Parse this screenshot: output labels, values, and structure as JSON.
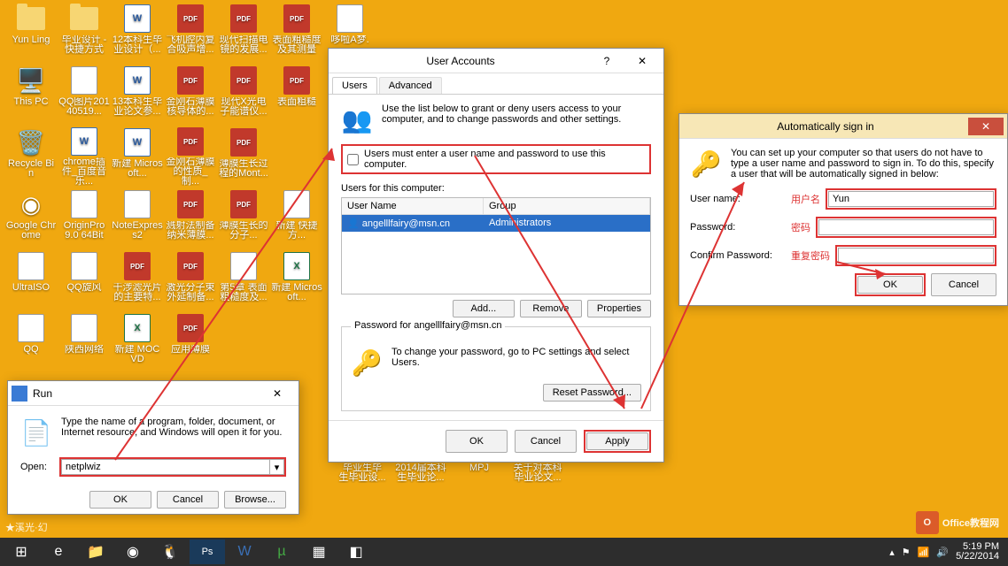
{
  "desktop_icons": [
    {
      "label": "Yun Ling",
      "type": "folder"
    },
    {
      "label": "毕业设计 - 快捷方式",
      "type": "folder"
    },
    {
      "label": "12本科生毕业设计（...",
      "type": "docx"
    },
    {
      "label": "飞机腔内复合吸声增...",
      "type": "pdf"
    },
    {
      "label": "现代扫描电镜的发展...",
      "type": "pdf"
    },
    {
      "label": "表面粗糙度及其测量",
      "type": "pdf"
    },
    {
      "label": "哆啦A梦.",
      "type": "gen"
    },
    {
      "label": "This PC",
      "type": "pc"
    },
    {
      "label": "QQ图片20140519...",
      "type": "gen"
    },
    {
      "label": "13本科生毕业论文参...",
      "type": "docx"
    },
    {
      "label": "金刚石薄膜核导体的...",
      "type": "pdf"
    },
    {
      "label": "现代X光电子能谱仪...",
      "type": "pdf"
    },
    {
      "label": "表面粗糙",
      "type": "pdf"
    },
    {
      "label": "",
      "type": "blank"
    },
    {
      "label": "Recycle Bin",
      "type": "bin"
    },
    {
      "label": "chrome插件_百度音乐...",
      "type": "docx"
    },
    {
      "label": "新建 Microsoft...",
      "type": "docx"
    },
    {
      "label": "金刚石薄膜的性质_制...",
      "type": "pdf"
    },
    {
      "label": "薄膜生长过程的Mont...",
      "type": "pdf"
    },
    {
      "label": "",
      "type": "blank"
    },
    {
      "label": "",
      "type": "blank"
    },
    {
      "label": "Google Chrome",
      "type": "chrome"
    },
    {
      "label": "OriginPro 9.0 64Bit",
      "type": "gen"
    },
    {
      "label": "NoteExpress2",
      "type": "gen"
    },
    {
      "label": "溅射法制备纳米薄膜...",
      "type": "pdf"
    },
    {
      "label": "薄膜生长的分子...",
      "type": "pdf"
    },
    {
      "label": "新建 快捷方...",
      "type": "gen"
    },
    {
      "label": "",
      "type": "blank"
    },
    {
      "label": "UltraISO",
      "type": "gen"
    },
    {
      "label": "QQ旋风",
      "type": "gen"
    },
    {
      "label": "干涉滤光片的主要特...",
      "type": "pdf"
    },
    {
      "label": "激光分子束外延制备...",
      "type": "pdf"
    },
    {
      "label": "第5章 表面粗糙度及...",
      "type": "gen"
    },
    {
      "label": "新建 Microsoft...",
      "type": "xlsx"
    },
    {
      "label": "",
      "type": "blank"
    },
    {
      "label": "QQ",
      "type": "gen"
    },
    {
      "label": "陕西网络",
      "type": "gen"
    },
    {
      "label": "新建 MOCVD",
      "type": "xlsx"
    },
    {
      "label": "应用薄膜",
      "type": "pdf"
    },
    {
      "label": "",
      "type": "blank"
    },
    {
      "label": "",
      "type": "blank"
    },
    {
      "label": "",
      "type": "blank"
    }
  ],
  "extra_icons": [
    {
      "label": "毕业生毕 生毕业设...",
      "type": "docx"
    },
    {
      "label": "2014届本科生毕业论...",
      "type": "xlsx"
    },
    {
      "label": "MPJ",
      "type": "gen"
    },
    {
      "label": "关于对本科毕业论文...",
      "type": "docx"
    }
  ],
  "run": {
    "title": "Run",
    "instruction": "Type the name of a program, folder, document, or Internet resource, and Windows will open it for you.",
    "open_label": "Open:",
    "value": "netplwiz",
    "ok": "OK",
    "cancel": "Cancel",
    "browse": "Browse..."
  },
  "ua": {
    "title": "User Accounts",
    "tab_users": "Users",
    "tab_adv": "Advanced",
    "instruction": "Use the list below to grant or deny users access to your computer, and to change passwords and other settings.",
    "checkbox": "Users must enter a user name and password to use this computer.",
    "list_label": "Users for this computer:",
    "col_user": "User Name",
    "col_group": "Group",
    "row_user": "angelllfairy@msn.cn",
    "row_group": "Administrators",
    "add": "Add...",
    "remove": "Remove",
    "props": "Properties",
    "pwd_for": "Password for angelllfairy@msn.cn",
    "pwd_text": "To change your password, go to PC settings and select Users.",
    "reset": "Reset Password...",
    "ok": "OK",
    "cancel": "Cancel",
    "apply": "Apply"
  },
  "auto": {
    "title": "Automatically sign in",
    "text": "You can set up your computer so that users do not have to type a user name and password to sign in. To do this, specify a user that will be automatically signed in below:",
    "user_label": "User name:",
    "user_note": "用户名",
    "user_value": "Yun",
    "pwd_label": "Password:",
    "pwd_note": "密码",
    "confirm_label": "Confirm Password:",
    "confirm_note": "重复密码",
    "ok": "OK",
    "cancel": "Cancel"
  },
  "taskbar": {
    "time": "5:19 PM",
    "date": "5/22/2014"
  },
  "watermark": "Office教程网",
  "corner_text": "★溪光·幻"
}
